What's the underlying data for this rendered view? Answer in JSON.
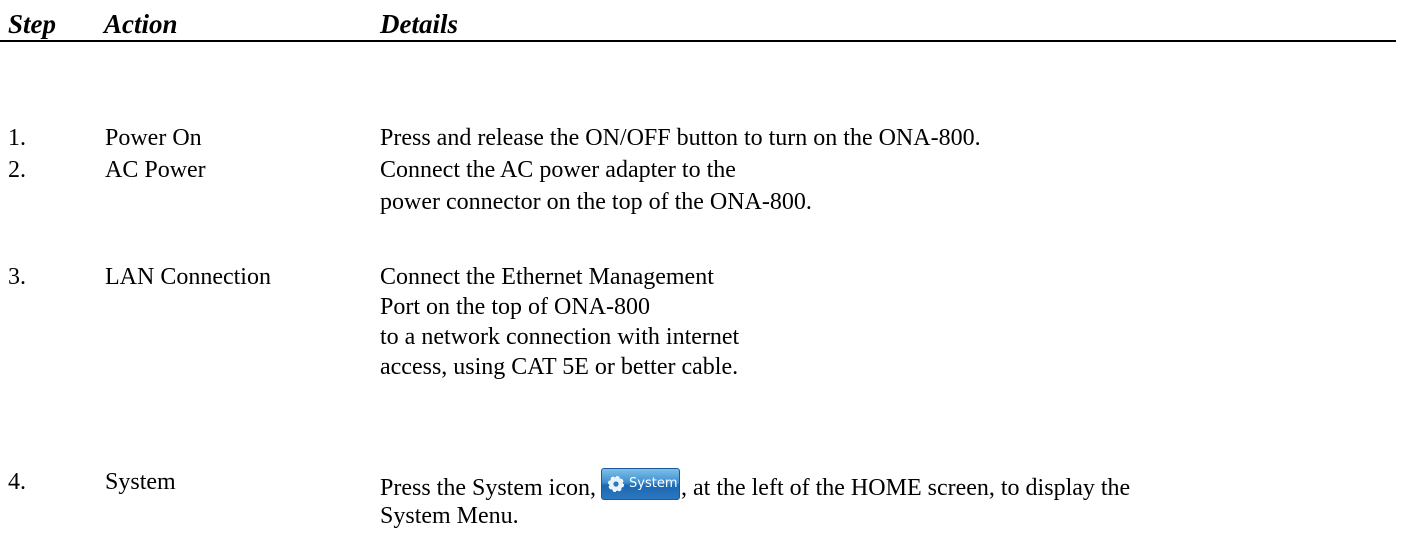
{
  "header": {
    "step": "Step",
    "action": "Action",
    "details": "Details"
  },
  "steps": [
    {
      "num": "1.",
      "action": "Power On",
      "details": [
        "Press and release the ON/OFF button to turn on the ONA-800."
      ]
    },
    {
      "num": "2.",
      "action": "AC Power",
      "details": [
        "Connect the AC power adapter to the",
        "power connector on the top of the ONA-800."
      ]
    },
    {
      "num": "3.",
      "action": "LAN Connection",
      "details": [
        "Connect the Ethernet Management",
        "Port on the top of ONA-800",
        "to a network connection with internet",
        "access, using CAT 5E or better cable."
      ]
    },
    {
      "num": "4.",
      "action": "System",
      "details_before_icon": "Press the System icon,",
      "details_after_icon": ", at the left of the HOME screen, to display the",
      "details_line2": "System Menu.",
      "icon": {
        "name": "gear-icon",
        "label": "System"
      }
    }
  ]
}
